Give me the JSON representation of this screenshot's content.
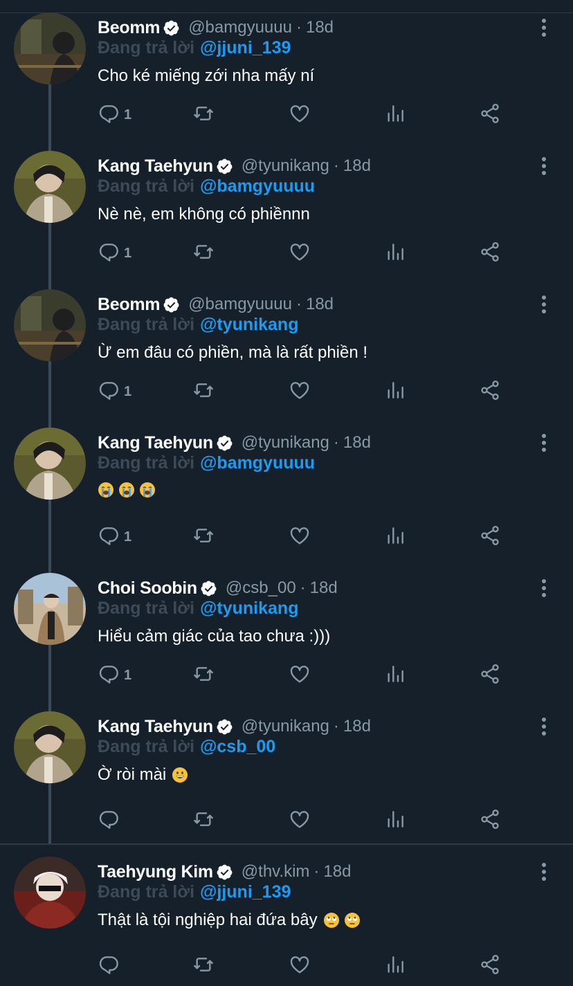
{
  "reply_label": "Đang trả lời",
  "tweets": [
    {
      "name": "Beomm",
      "handle": "@bamgyuuuu",
      "time": "18d",
      "reply_to": "@jjuni_139",
      "text": "Cho ké miếng zới nha mấy ní",
      "emojis": [],
      "reply_count": "1",
      "avatar": "beomm"
    },
    {
      "name": "Kang Taehyun",
      "handle": "@tyunikang",
      "time": "18d",
      "reply_to": "@bamgyuuuu",
      "text": "Nè nè, em không có phiềnnn",
      "emojis": [],
      "reply_count": "1",
      "avatar": "taehyun"
    },
    {
      "name": "Beomm",
      "handle": "@bamgyuuuu",
      "time": "18d",
      "reply_to": "@tyunikang",
      "text": "Ừ em đâu có phiền, mà là rất phiền !",
      "emojis": [],
      "reply_count": "1",
      "avatar": "beomm"
    },
    {
      "name": "Kang Taehyun",
      "handle": "@tyunikang",
      "time": "18d",
      "reply_to": "@bamgyuuuu",
      "text": "",
      "emojis": [
        "loudly-crying-face",
        "loudly-crying-face",
        "loudly-crying-face"
      ],
      "reply_count": "1",
      "avatar": "taehyun"
    },
    {
      "name": "Choi Soobin",
      "handle": "@csb_00",
      "time": "18d",
      "reply_to": "@tyunikang",
      "text": "Hiểu cảm giác của tao chưa :)))",
      "emojis": [],
      "reply_count": "1",
      "avatar": "soobin"
    },
    {
      "name": "Kang Taehyun",
      "handle": "@tyunikang",
      "time": "18d",
      "reply_to": "@csb_00",
      "text": "Ờ ròi mài",
      "emojis": [
        "grinning-face"
      ],
      "reply_count": "",
      "avatar": "taehyun"
    },
    {
      "name": "Taehyung Kim",
      "handle": "@thv.kim",
      "time": "18d",
      "reply_to": "@jjuni_139",
      "text": "Thật là tội nghiệp hai đứa bây",
      "emojis": [
        "face-with-rolling-eyes",
        "face-with-rolling-eyes"
      ],
      "reply_count": "",
      "avatar": "taehyung"
    }
  ],
  "colors": {
    "background": "#15202b",
    "mention": "#1d9bf0",
    "secondary": "#8899a6",
    "verified": "#ffffff"
  }
}
